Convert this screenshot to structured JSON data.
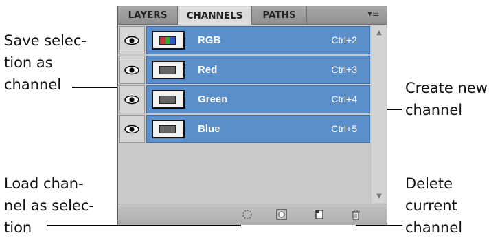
{
  "callouts": {
    "save_selection": "Save selec-\ntion as\nchannel",
    "create_channel": "Create new\nchannel",
    "load_channel": "Load chan-\nnel as selec-\ntion",
    "delete_channel": "Delete\ncurrent\nchannel"
  },
  "panel": {
    "tabs": [
      {
        "label": "LAYERS",
        "active": false
      },
      {
        "label": "CHANNELS",
        "active": true
      },
      {
        "label": "PATHS",
        "active": false
      }
    ],
    "menu_icon": "panel-menu-icon",
    "selection_color": "#5b8fcb",
    "channels": [
      {
        "name": "RGB",
        "shortcut": "Ctrl+2"
      },
      {
        "name": "Red",
        "shortcut": "Ctrl+3"
      },
      {
        "name": "Green",
        "shortcut": "Ctrl+4"
      },
      {
        "name": "Blue",
        "shortcut": "Ctrl+5"
      }
    ],
    "footer_icons": [
      "load-selection-icon",
      "save-selection-icon",
      "new-channel-icon",
      "trash-icon"
    ]
  }
}
